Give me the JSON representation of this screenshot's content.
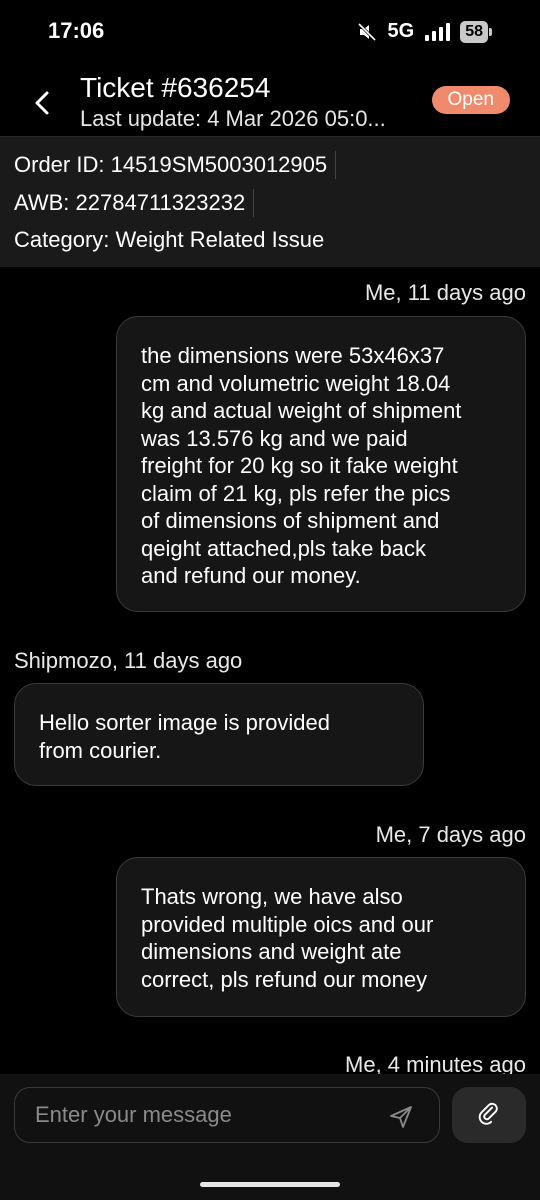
{
  "status_bar": {
    "time": "17:06",
    "network": "5G",
    "battery": "58",
    "icons": [
      "mute-icon",
      "signal-icon",
      "battery-icon"
    ]
  },
  "header": {
    "title": "Ticket #636254",
    "subtitle": "Last update: 4 Mar 2026 05:0...",
    "status": "Open",
    "status_color": "#f08a6c"
  },
  "info": {
    "order_label": "Order ID:",
    "order_value": "14519SM5003012905",
    "awb_label": "AWB:",
    "awb_value": "22784711323232",
    "category_label": "Category:",
    "category_value": "Weight Related Issue"
  },
  "messages": [
    {
      "sender": "Me, 11 days ago",
      "direction": "out",
      "lines": [
        "the dimensions were 53x46x37",
        "cm and volumetric weight 18.04",
        "kg and actual weight of shipment",
        "was 13.576 kg and we paid",
        "freight for 20 kg so it fake weight",
        "claim  of 21 kg,  pls refer the pics",
        "of dimensions of shipment and",
        "qeight attached,pls take back",
        "and refund our money."
      ]
    },
    {
      "sender": "Shipmozo, 11 days ago",
      "direction": "in",
      "lines": [
        "Hello sorter image is provided",
        "from courier."
      ]
    },
    {
      "sender": "Me, 7 days ago",
      "direction": "out",
      "lines": [
        "Thats wrong, we have also",
        "provided multiple oics and  our",
        "dimensions and weight ate",
        "correct, pls refund our money"
      ]
    },
    {
      "sender": "Me, 4 minutes ago",
      "direction": "out",
      "lines": []
    }
  ],
  "composer": {
    "placeholder": "Enter your message",
    "send_icon": "send-icon",
    "attach_icon": "paperclip-icon"
  },
  "colors": {
    "background": "#000000",
    "panel": "#1a1a1a",
    "bubble": "#161616",
    "badge": "#f08a6c"
  }
}
